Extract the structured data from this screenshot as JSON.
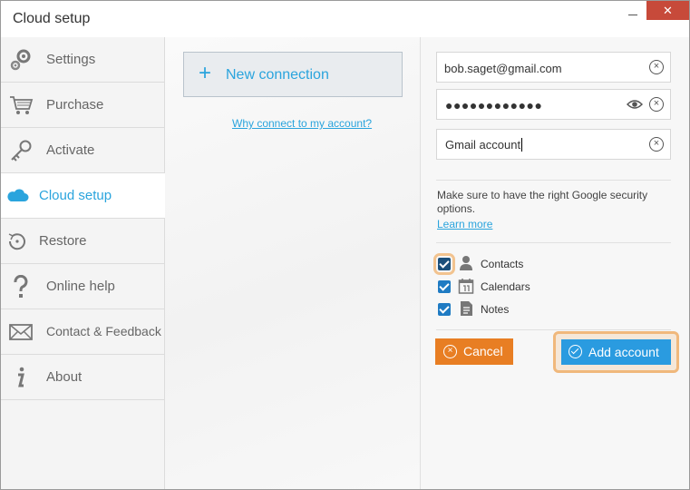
{
  "window": {
    "title": "Cloud setup",
    "close_glyph": "✕"
  },
  "sidebar": {
    "items": [
      {
        "label": "Settings",
        "icon": "gears-icon"
      },
      {
        "label": "Purchase",
        "icon": "cart-icon"
      },
      {
        "label": "Activate",
        "icon": "key-icon"
      },
      {
        "label": "Cloud setup",
        "icon": "cloud-icon",
        "active": true
      },
      {
        "label": "Restore",
        "icon": "restore-icon"
      },
      {
        "label": "Online help",
        "icon": "question-icon"
      },
      {
        "label": "Contact & Feedback",
        "icon": "envelope-icon"
      },
      {
        "label": "About",
        "icon": "info-icon"
      }
    ]
  },
  "connection": {
    "new_label": "New connection",
    "plus_glyph": "+",
    "why_link": "Why connect to my account?"
  },
  "form": {
    "email": "bob.saget@gmail.com",
    "password_mask": "●●●●●●●●●●●●",
    "account_name": "Gmail account",
    "clear_glyph": "×",
    "note": "Make sure to have the right Google security options.",
    "learn_more": "Learn more",
    "options": [
      {
        "label": "Contacts",
        "checked": true,
        "icon": "person-icon"
      },
      {
        "label": "Calendars",
        "checked": true,
        "icon": "calendar-icon"
      },
      {
        "label": "Notes",
        "checked": true,
        "icon": "note-icon"
      }
    ],
    "cancel_label": "Cancel",
    "add_label": "Add account"
  },
  "colors": {
    "accent": "#2aa4dd",
    "cancel": "#e87e23",
    "add": "#2a9be0",
    "highlight": "#f0b87c"
  }
}
